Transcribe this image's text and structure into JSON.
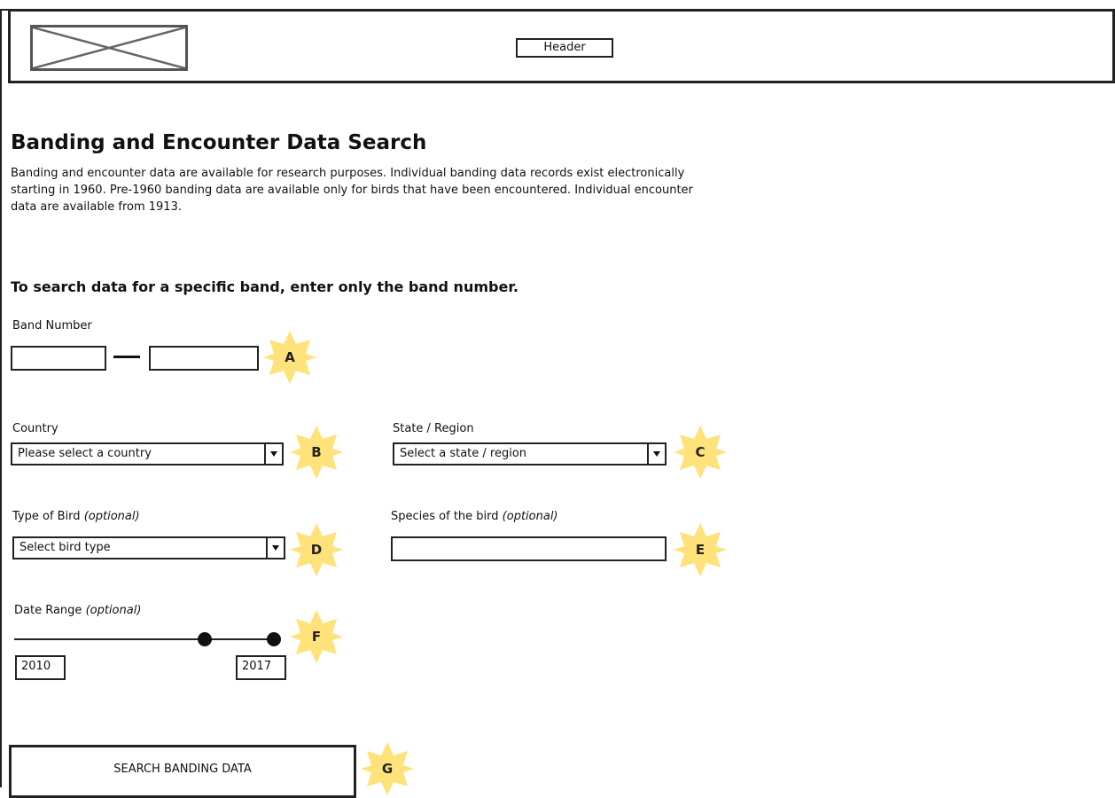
{
  "header": {
    "button_label": "Header"
  },
  "page": {
    "title": "Banding and Encounter Data Search",
    "intro": "Banding and encounter data are available for research purposes. Individual banding data records exist electronically starting in 1960. Pre-1960 banding data are available only for birds that have been encountered. Individual encounter data are available from 1913.",
    "subheading": "To search data for a specific band, enter only the band number."
  },
  "form": {
    "band_number_label": "Band Number",
    "country_label": "Country",
    "country_value": "Please select a country",
    "state_label": "State / Region",
    "state_value": "Select a state / region",
    "bird_type_label": "Type of Bird",
    "bird_type_optional": "(optional)",
    "bird_type_value": "Select bird type",
    "species_label": "Species of the bird",
    "species_optional": "(optional)",
    "date_range_label": "Date Range",
    "date_range_optional": "(optional)",
    "date_start": "2010",
    "date_end": "2017",
    "search_button": "SEARCH BANDING DATA"
  },
  "annotations": [
    "A",
    "B",
    "C",
    "D",
    "E",
    "F",
    "G"
  ],
  "colors": {
    "annotation": "#ffe27a",
    "stroke": "#222222"
  }
}
